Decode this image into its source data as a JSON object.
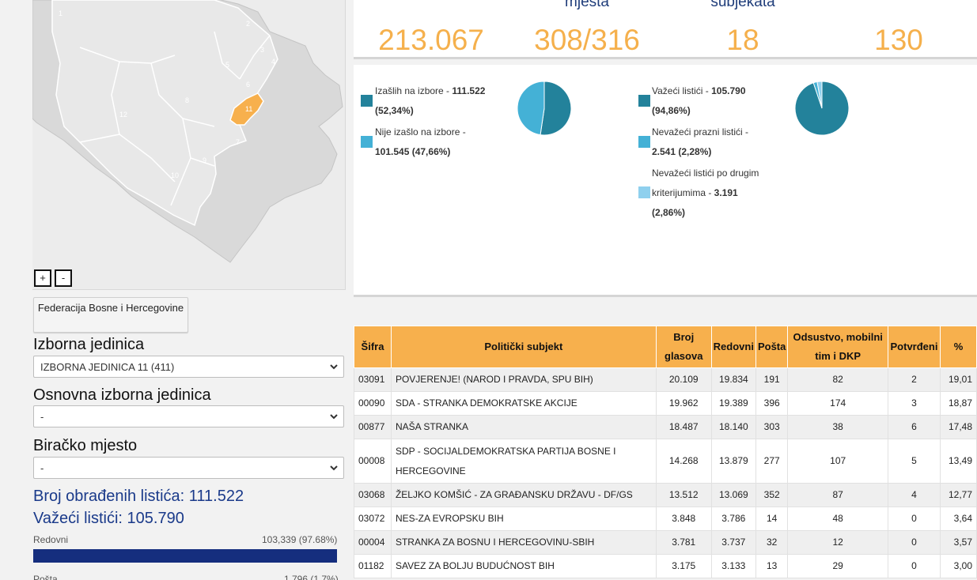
{
  "map": {
    "zoom_in": "+",
    "zoom_out": "-",
    "region_labels": [
      "1",
      "2",
      "3",
      "4",
      "5",
      "6",
      "7",
      "8",
      "9",
      "10",
      "11",
      "12"
    ],
    "selected_region": "11",
    "colors": {
      "land": "#d9d9d9",
      "inner": "#e6e6e6",
      "selected": "#f7b04d",
      "border": "#ffffff"
    }
  },
  "left": {
    "federation_button": "Federacija Bosne i Hercegovine",
    "izborna_label": "Izborna jedinica",
    "izborna_value": "IZBORNA JEDINICA 11 (411)",
    "osnovna_label": "Osnovna izborna jedinica",
    "osnovna_value": "-",
    "biracko_label": "Biračko mjesto",
    "biracko_value": "-",
    "obradjenih": "Broj obrađenih listića: 111.522",
    "vazeci": "Važeći listići: 105.790",
    "redovni_label": "Redovni",
    "redovni_value": "103,339 (97.68%)",
    "redovni_fraction": 0.9768,
    "posta_label": "Pošta",
    "posta_value": "1,796 (1.7%)"
  },
  "top": {
    "labels": [
      "",
      "mjesta",
      "subjekata",
      ""
    ],
    "values": [
      "213.067",
      "308/316",
      "18",
      "130"
    ]
  },
  "turnout": {
    "izaslih_label": "Izašlih na izbore - ",
    "izaslih_value": "111.522",
    "izaslih_pct": "(52,34%)",
    "nije_label": "Nije izašlo na izbore -",
    "nije_value": "101.545 (47,66%)",
    "pie": [
      52.34,
      47.66
    ],
    "colors": [
      "#23829b",
      "#44b1d6"
    ]
  },
  "ballots": {
    "vazeci_label": "Važeći listići - ",
    "vazeci_value": "105.790",
    "vazeci_pct": "(94,86%)",
    "prazni_label": "Nevažeći prazni listići -",
    "prazni_value": "2.541 (2,28%)",
    "drugi_label1": "Nevažeći listići po drugim",
    "drugi_label2": "kriterijumima - ",
    "drugi_value": "3.191",
    "drugi_pct": "(2,86%)",
    "pie": [
      94.86,
      2.28,
      2.86
    ],
    "colors": [
      "#23829b",
      "#44b1d6",
      "#8fd0ee"
    ]
  },
  "table": {
    "headers": {
      "sifra": "Šifra",
      "subjekt": "Politički subjekt",
      "broj1": "Broj",
      "broj2": "glasova",
      "redovni": "Redovni",
      "posta": "Pošta",
      "odsustvo1": "Odsustvo, mobilni",
      "odsustvo2": "tim i DKP",
      "potvrdeni": "Potvrđeni",
      "pct": "%"
    },
    "rows": [
      {
        "sifra": "03091",
        "name1": "POVJERENJE! (NAROD I PRAVDA, SPU BIH)",
        "name2": "",
        "broj": "20.109",
        "redovni": "19.834",
        "posta": "191",
        "odsustvo": "82",
        "potvrdeni": "2",
        "pct": "19,01"
      },
      {
        "sifra": "00090",
        "name1": "SDA - STRANKA DEMOKRATSKE AKCIJE",
        "name2": "",
        "broj": "19.962",
        "redovni": "19.389",
        "posta": "396",
        "odsustvo": "174",
        "potvrdeni": "3",
        "pct": "18,87"
      },
      {
        "sifra": "00877",
        "name1": "NAŠA STRANKA",
        "name2": "",
        "broj": "18.487",
        "redovni": "18.140",
        "posta": "303",
        "odsustvo": "38",
        "potvrdeni": "6",
        "pct": "17,48"
      },
      {
        "sifra": "00008",
        "name1": "SDP - SOCIJALDEMOKRATSKA PARTIJA BOSNE I",
        "name2": "HERCEGOVINE",
        "broj": "14.268",
        "redovni": "13.879",
        "posta": "277",
        "odsustvo": "107",
        "potvrdeni": "5",
        "pct": "13,49"
      },
      {
        "sifra": "03068",
        "name1": "ŽELJKO KOMŠIĆ - ZA GRAĐANSKU DRŽAVU - DF/GS",
        "name2": "",
        "broj": "13.512",
        "redovni": "13.069",
        "posta": "352",
        "odsustvo": "87",
        "potvrdeni": "4",
        "pct": "12,77"
      },
      {
        "sifra": "03072",
        "name1": "NES-ZA EVROPSKU BIH",
        "name2": "",
        "broj": "3.848",
        "redovni": "3.786",
        "posta": "14",
        "odsustvo": "48",
        "potvrdeni": "0",
        "pct": "3,64"
      },
      {
        "sifra": "00004",
        "name1": "STRANKA ZA BOSNU I HERCEGOVINU-SBIH",
        "name2": "",
        "broj": "3.781",
        "redovni": "3.737",
        "posta": "32",
        "odsustvo": "12",
        "potvrdeni": "0",
        "pct": "3,57"
      },
      {
        "sifra": "01182",
        "name1": "SAVEZ ZA BOLJU BUDUĆNOST BIH",
        "name2": "",
        "broj": "3.175",
        "redovni": "3.133",
        "posta": "13",
        "odsustvo": "29",
        "potvrdeni": "0",
        "pct": "3,00"
      }
    ]
  }
}
